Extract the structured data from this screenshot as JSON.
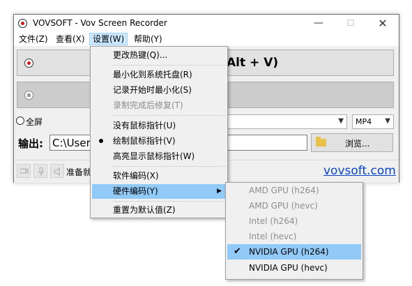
{
  "window": {
    "title": "VOVSOFT - Vov Screen Recorder",
    "controls": {
      "minimize": "—",
      "maximize": "☐",
      "close": "✕"
    }
  },
  "menubar": {
    "items": [
      {
        "label": "文件(Z)"
      },
      {
        "label": "查看(X)"
      },
      {
        "label": "设置(W)",
        "active": true
      },
      {
        "label": "帮助(Y)"
      }
    ]
  },
  "main": {
    "record_button_text": "Alt + V)",
    "fullscreen_label": "全屏",
    "format_value": "MP4",
    "output_label": "输出:",
    "output_path": "C:\\User",
    "browse_label": "浏览...",
    "status_text": "准备就",
    "website_link": "vovsoft.com"
  },
  "settings_menu": {
    "items": [
      {
        "label": "更改热键(Q)...",
        "disabled": false
      },
      {
        "label": "最小化到系统托盘(R)",
        "disabled": false
      },
      {
        "label": "记录开始时最小化(S)",
        "disabled": false
      },
      {
        "label": "录制完成后修复(T)",
        "disabled": true
      },
      {
        "label": "没有鼠标指针(U)",
        "disabled": false
      },
      {
        "label": "绘制鼠标指针(V)",
        "disabled": false,
        "selected": true
      },
      {
        "label": "高亮显示鼠标指针(W)",
        "disabled": false
      },
      {
        "label": "软件编码(X)",
        "disabled": false
      },
      {
        "label": "硬件编码(Y)",
        "disabled": false,
        "highlighted": true,
        "has_submenu": true
      },
      {
        "label": "重置为默认值(Z)",
        "disabled": false
      }
    ]
  },
  "hardware_submenu": {
    "items": [
      {
        "label": "AMD GPU (h264)",
        "disabled": true
      },
      {
        "label": "AMD GPU (hevc)",
        "disabled": true
      },
      {
        "label": "Intel (h264)",
        "disabled": true
      },
      {
        "label": "Intel (hevc)",
        "disabled": true
      },
      {
        "label": "NVIDIA GPU (h264)",
        "disabled": false,
        "checked": true,
        "highlighted": true
      },
      {
        "label": "NVIDIA GPU (hevc)",
        "disabled": false
      }
    ]
  },
  "colors": {
    "highlight": "#91c9f7",
    "link": "#0645c8",
    "record_red": "#d01818"
  }
}
